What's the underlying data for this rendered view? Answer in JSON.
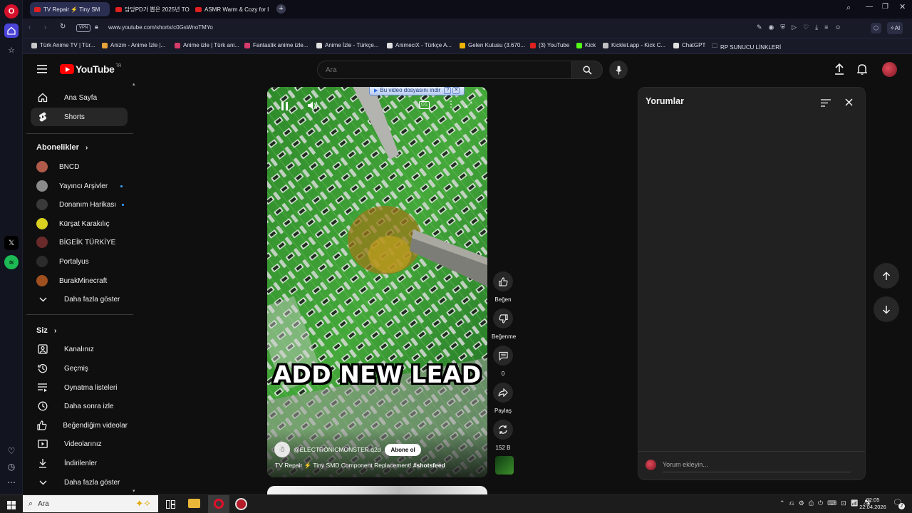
{
  "browser": {
    "tabs": [
      {
        "label": "TV Repair ⚡ Tiny SM",
        "active": true
      },
      {
        "label": "담당PD가 뽑은 2025년 TO",
        "active": false
      },
      {
        "label": "ASMR Warm & Cozy for I",
        "active": false
      }
    ],
    "vpn_label": "VPN",
    "url": "www.youtube.com/shorts/c0GsWnoTMYo",
    "ai_label": "AI",
    "bookmarks": [
      {
        "label": "Türk Anime TV | Tür...",
        "color": "#c7c7c7"
      },
      {
        "label": "Anizm - Anime İzle |...",
        "color": "#e8a23a"
      },
      {
        "label": "Anime izle | Türk ani...",
        "color": "#d63b6a"
      },
      {
        "label": "Fantastik anime izle...",
        "color": "#d63b6a"
      },
      {
        "label": "Anime İzle - Türkçe...",
        "color": "#e0e0e0"
      },
      {
        "label": "AnimeciX - Türkçe A...",
        "color": "#e0e0e0"
      },
      {
        "label": "Gelen Kutusu (3.670...",
        "color": "#f0b400"
      },
      {
        "label": "(3) YouTube",
        "color": "#e02020"
      },
      {
        "label": "Kick",
        "color": "#53fc18"
      },
      {
        "label": "Kicklet.app - Kick C...",
        "color": "#bfbfbf"
      },
      {
        "label": "ChatGPT",
        "color": "#e0e0e0"
      },
      {
        "label": "RP SUNUCU LİNKLERİ",
        "color": "#e0e0e0"
      }
    ]
  },
  "youtube": {
    "logo_text": "YouTube",
    "logo_region": "TR",
    "search_placeholder": "Ara",
    "sidebar": {
      "top": [
        {
          "label": "Ana Sayfa",
          "icon": "home-icon",
          "active": false
        },
        {
          "label": "Shorts",
          "icon": "shorts-icon",
          "active": true
        }
      ],
      "subs_header": "Abonelikler",
      "subscriptions": [
        {
          "label": "BNCD",
          "color": "#b05a4a",
          "dot": false
        },
        {
          "label": "Yayıncı Arşivler",
          "color": "#8a8a8a",
          "dot": true
        },
        {
          "label": "Donanım Harikası",
          "color": "#3a3a3a",
          "dot": true
        },
        {
          "label": "Kürşat Karakılıç",
          "color": "#d9d020",
          "dot": false
        },
        {
          "label": "BİGEİK TÜRKİYE",
          "color": "#6a2a2a",
          "dot": false
        },
        {
          "label": "Portalyus",
          "color": "#2b2b2b",
          "dot": false
        },
        {
          "label": "BurakMinecraft",
          "color": "#a0501e",
          "dot": false
        }
      ],
      "show_more": "Daha fazla göster",
      "you_header": "Siz",
      "you_items": [
        {
          "label": "Kanalınız",
          "icon": "channel-icon"
        },
        {
          "label": "Geçmiş",
          "icon": "history-icon"
        },
        {
          "label": "Oynatma listeleri",
          "icon": "playlist-icon"
        },
        {
          "label": "Daha sonra izle",
          "icon": "clock-icon"
        },
        {
          "label": "Beğendiğim videolar",
          "icon": "like-icon"
        },
        {
          "label": "Videolarınız",
          "icon": "video-icon"
        },
        {
          "label": "İndirilenler",
          "icon": "download-icon"
        },
        {
          "label": "Daha fazla göster",
          "icon": "chevron-down-icon"
        }
      ]
    },
    "video": {
      "download_banner": "Bu video dosyasını indir",
      "overlay_text": "ADD NEW LEAD",
      "channel": "@ELECTRONICMONSTER.q2d",
      "subscribe_label": "Abone ol",
      "title": "TV Repair ⚡ Tiny SMD Component Replacement!",
      "hashtag": "#shotsfeed"
    },
    "actions": {
      "like": "Beğen",
      "dislike": "Beğenme",
      "comments": "0",
      "share": "Paylaş",
      "remix": "152 B"
    },
    "comments_panel": {
      "title": "Yorumlar",
      "add_placeholder": "Yorum ekleyin..."
    }
  },
  "taskbar": {
    "search_label": "Ara",
    "time": "02:05",
    "date": "22.04.2026",
    "notifications": "2"
  }
}
